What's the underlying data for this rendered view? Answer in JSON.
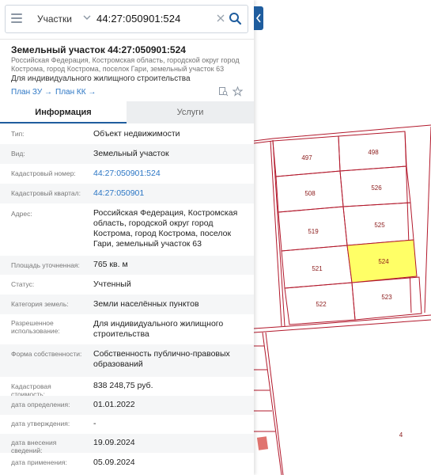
{
  "search": {
    "type_label": "Участки",
    "query": "44:27:050901:524"
  },
  "parcel": {
    "title": "Земельный участок 44:27:050901:524",
    "address_line": "Российская Федерация, Костромская область, городской округ город Кострома, город Кострома, поселок Гари, земельный участок 63",
    "purpose": "Для индивидуального жилищного строительства",
    "plan_zu_label": "План ЗУ →",
    "plan_kk_label": "План КК →"
  },
  "tabs": {
    "info": "Информация",
    "services": "Услуги"
  },
  "info_rows": [
    {
      "label": "Тип:",
      "value": "Объект недвижимости"
    },
    {
      "label": "Вид:",
      "value": "Земельный участок"
    },
    {
      "label": "Кадастровый номер:",
      "value": "44:27:050901:524"
    },
    {
      "label": "Кадастровый квартал:",
      "value": "44:27:050901"
    },
    {
      "label": "Адрес:",
      "value": "Российская Федерация, Костромская область, городской округ город Кострома, город Кострома, поселок Гари, земельный участок 63"
    },
    {
      "label": "Площадь уточненная:",
      "value": "765 кв. м"
    },
    {
      "label": "Статус:",
      "value": "Учтенный"
    },
    {
      "label": "Категория земель:",
      "value": "Земли населённых пунктов"
    },
    {
      "label": "Разрешенное использование:",
      "value": "Для индивидуального жилищного строительства"
    },
    {
      "label": "Форма собственности:",
      "value": "Собственность публично-правовых образований"
    },
    {
      "label": "Кадастровая стоимость:",
      "value": "838 248,75 руб."
    },
    {
      "label": "дата определения:",
      "value": "01.01.2022"
    },
    {
      "label": "дата утверждения:",
      "value": "-"
    },
    {
      "label": "дата внесения сведений:",
      "value": "19.09.2024"
    },
    {
      "label": "дата применения:",
      "value": "05.09.2024"
    }
  ],
  "map": {
    "parcel_labels": [
      "497",
      "498",
      "508",
      "526",
      "519",
      "525",
      "521",
      "524",
      "522",
      "523",
      "4"
    ],
    "selected_parcel": "524",
    "boundary_color": "#b2182b",
    "selected_fill": "#ffff66",
    "link_color": "#2a75c4",
    "accent_color": "#1f5d9e"
  }
}
